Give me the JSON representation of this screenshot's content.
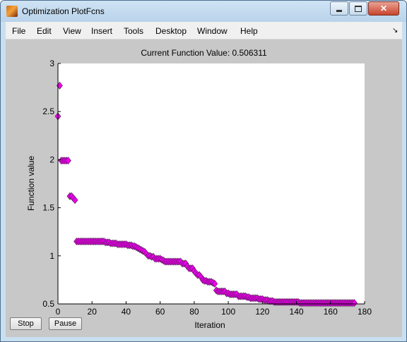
{
  "window": {
    "title": "Optimization PlotFcns",
    "controls": {
      "minimize": "minimize-icon",
      "maximize": "maximize-icon",
      "close_glyph": "✕"
    }
  },
  "menu": {
    "items": [
      "File",
      "Edit",
      "View",
      "Insert",
      "Tools",
      "Desktop",
      "Window",
      "Help"
    ],
    "dock_glyph": "↘"
  },
  "plot": {
    "title": "Current Function Value: 0.506311"
  },
  "buttons": {
    "stop": "Stop",
    "pause": "Pause"
  },
  "colors": {
    "marker_fill": "#ee00ee",
    "marker_edge": "#4a1a4a",
    "axes_background": "#ffffff",
    "figure_background": "#c8c8c8"
  },
  "chart_data": {
    "type": "scatter",
    "title": "Current Function Value: 0.506311",
    "xlabel": "Iteration",
    "ylabel": "Function value",
    "xlim": [
      0,
      180
    ],
    "ylim": [
      0.5,
      3
    ],
    "xticks": [
      "0",
      "20",
      "40",
      "60",
      "80",
      "100",
      "120",
      "140",
      "160",
      "180"
    ],
    "yticks": [
      "0.5",
      "1",
      "1.5",
      "2",
      "2.5",
      "3"
    ],
    "marker": "diamond",
    "x": [
      0,
      1,
      2,
      3,
      4,
      5,
      6,
      7,
      8,
      9,
      10,
      11,
      12,
      13,
      14,
      15,
      16,
      17,
      18,
      19,
      20,
      21,
      22,
      23,
      24,
      25,
      26,
      27,
      28,
      29,
      30,
      31,
      32,
      33,
      34,
      35,
      36,
      37,
      38,
      39,
      40,
      41,
      42,
      43,
      44,
      45,
      46,
      47,
      48,
      49,
      50,
      51,
      52,
      53,
      54,
      55,
      56,
      57,
      58,
      59,
      60,
      61,
      62,
      63,
      64,
      65,
      66,
      67,
      68,
      69,
      70,
      71,
      72,
      73,
      74,
      75,
      76,
      77,
      78,
      79,
      80,
      81,
      82,
      83,
      84,
      85,
      86,
      87,
      88,
      89,
      90,
      91,
      92,
      93,
      94,
      95,
      96,
      97,
      98,
      99,
      100,
      101,
      102,
      103,
      104,
      105,
      106,
      107,
      108,
      109,
      110,
      111,
      112,
      113,
      114,
      115,
      116,
      117,
      118,
      119,
      120,
      121,
      122,
      123,
      124,
      125,
      126,
      127,
      128,
      129,
      130,
      131,
      132,
      133,
      134,
      135,
      136,
      137,
      138,
      139,
      140,
      141,
      142,
      143,
      144,
      145,
      146,
      147,
      148,
      149,
      150,
      151,
      152,
      153,
      154,
      155,
      156,
      157,
      158,
      159,
      160,
      161,
      162,
      163,
      164,
      165,
      166,
      167,
      168,
      169,
      170,
      171,
      172,
      173,
      174
    ],
    "y": [
      2.45,
      2.77,
      1.99,
      1.99,
      1.99,
      1.99,
      1.99,
      1.62,
      1.62,
      1.6,
      1.58,
      1.15,
      1.15,
      1.15,
      1.15,
      1.15,
      1.15,
      1.15,
      1.15,
      1.15,
      1.15,
      1.15,
      1.15,
      1.15,
      1.15,
      1.15,
      1.15,
      1.15,
      1.14,
      1.14,
      1.14,
      1.13,
      1.13,
      1.13,
      1.13,
      1.12,
      1.12,
      1.12,
      1.12,
      1.12,
      1.12,
      1.11,
      1.11,
      1.11,
      1.1,
      1.1,
      1.09,
      1.08,
      1.07,
      1.06,
      1.05,
      1.04,
      1.02,
      1.0,
      1.0,
      0.99,
      0.99,
      0.97,
      0.97,
      0.97,
      0.97,
      0.96,
      0.95,
      0.94,
      0.94,
      0.94,
      0.94,
      0.94,
      0.94,
      0.94,
      0.94,
      0.94,
      0.94,
      0.92,
      0.92,
      0.92,
      0.89,
      0.87,
      0.87,
      0.87,
      0.84,
      0.82,
      0.8,
      0.8,
      0.78,
      0.75,
      0.74,
      0.74,
      0.73,
      0.73,
      0.73,
      0.72,
      0.71,
      0.64,
      0.63,
      0.63,
      0.63,
      0.63,
      0.63,
      0.61,
      0.61,
      0.6,
      0.6,
      0.6,
      0.6,
      0.6,
      0.58,
      0.58,
      0.58,
      0.58,
      0.58,
      0.57,
      0.57,
      0.56,
      0.56,
      0.56,
      0.56,
      0.56,
      0.55,
      0.55,
      0.55,
      0.54,
      0.54,
      0.54,
      0.53,
      0.53,
      0.53,
      0.52,
      0.52,
      0.52,
      0.52,
      0.52,
      0.52,
      0.52,
      0.52,
      0.52,
      0.52,
      0.52,
      0.52,
      0.52,
      0.52,
      0.52,
      0.51,
      0.51,
      0.51,
      0.51,
      0.51,
      0.51,
      0.51,
      0.51,
      0.51,
      0.51,
      0.51,
      0.51,
      0.51,
      0.51,
      0.51,
      0.51,
      0.51,
      0.51,
      0.51,
      0.51,
      0.51,
      0.51,
      0.51,
      0.51,
      0.51,
      0.51,
      0.51,
      0.51,
      0.51,
      0.51,
      0.51,
      0.51,
      0.51,
      0.51,
      0.51
    ],
    "grid": false
  }
}
